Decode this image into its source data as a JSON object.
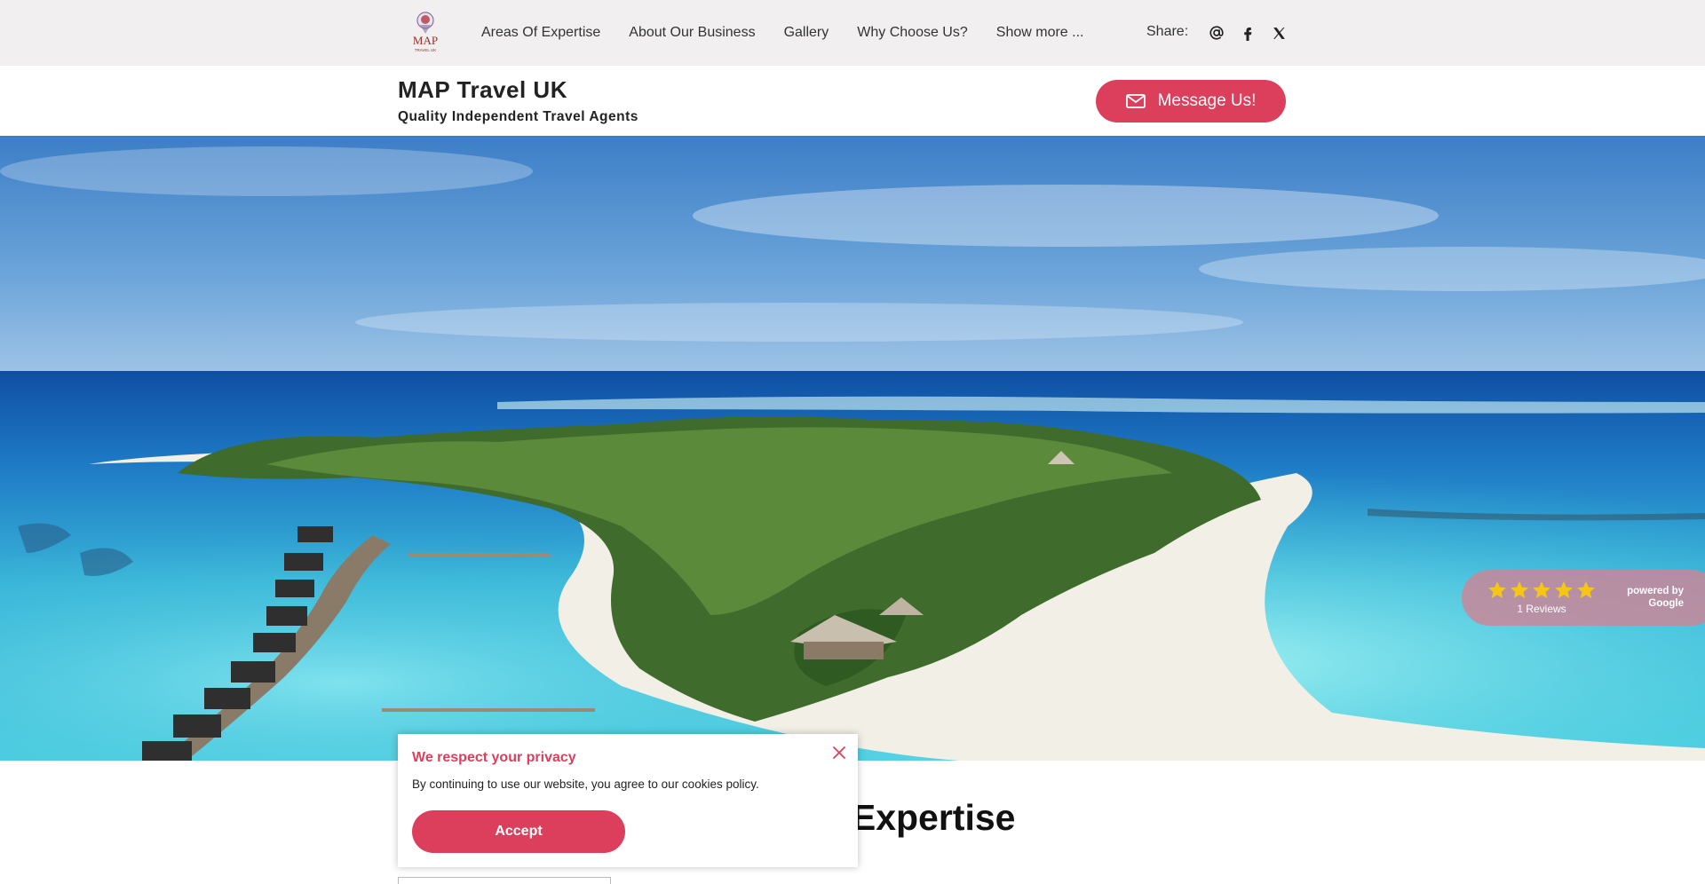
{
  "nav": {
    "logo_text": "MAP",
    "logo_subtext": "TRAVEL UK",
    "items": [
      {
        "label": "Areas Of Expertise"
      },
      {
        "label": "About Our Business"
      },
      {
        "label": "Gallery"
      },
      {
        "label": "Why Choose Us?"
      },
      {
        "label": "Show more ..."
      }
    ],
    "share_label": "Share:",
    "share_icons": [
      "at-icon",
      "facebook-icon",
      "x-icon"
    ]
  },
  "header": {
    "title": "MAP Travel UK",
    "subtitle": "Quality Independent Travel Agents",
    "message_button": "Message Us!"
  },
  "reviews": {
    "rating": 5,
    "rating_max": 5,
    "count_label": "1 Reviews",
    "powered_line1": "powered by",
    "powered_line2": "Google"
  },
  "main": {
    "heading": "Areas Of Expertise"
  },
  "cookie": {
    "title": "We respect your privacy",
    "text": "By continuing to use our website, you agree to our cookies policy.",
    "accept_label": "Accept"
  },
  "colors": {
    "accent": "#dc3f5c",
    "topbar_bg": "#f1efef"
  }
}
